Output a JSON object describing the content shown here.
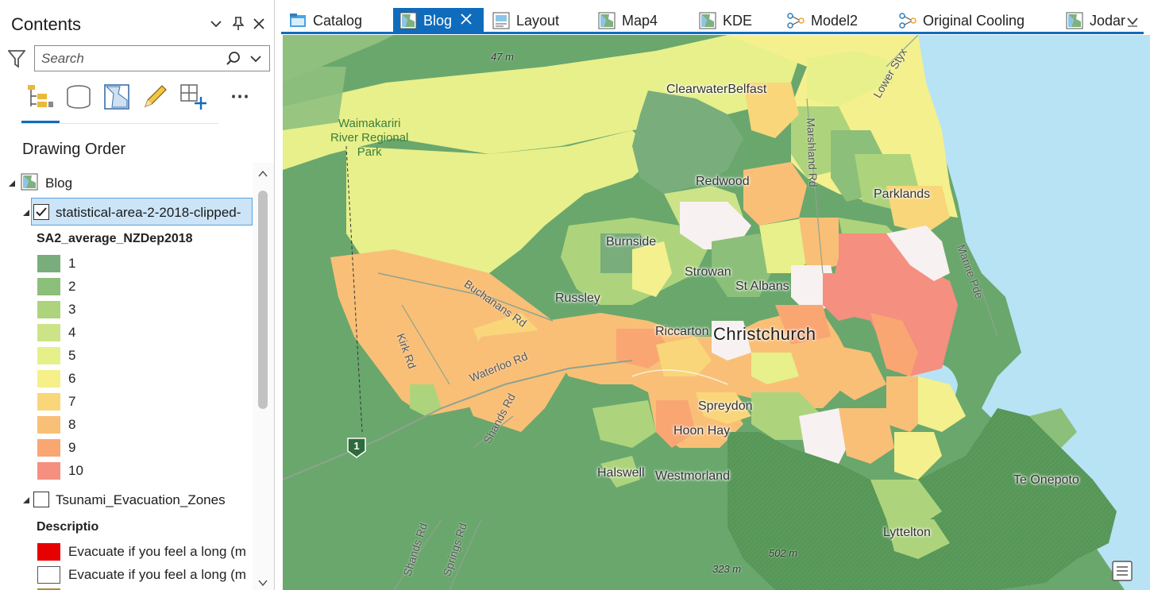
{
  "contents": {
    "title": "Contents",
    "search_placeholder": "Search",
    "section_title": "Drawing Order",
    "map_name": "Blog",
    "layer1": {
      "name": "statistical-area-2-2018-clipped-",
      "checked": true,
      "field": "SA2_average_NZDep2018",
      "classes": [
        {
          "label": "1",
          "color": "#79ae7c"
        },
        {
          "label": "2",
          "color": "#8cbf79"
        },
        {
          "label": "3",
          "color": "#add47c"
        },
        {
          "label": "4",
          "color": "#cde387"
        },
        {
          "label": "5",
          "color": "#e6f08a"
        },
        {
          "label": "6",
          "color": "#f6f08a"
        },
        {
          "label": "7",
          "color": "#f9d67a"
        },
        {
          "label": "8",
          "color": "#f9bf77"
        },
        {
          "label": "9",
          "color": "#f9a673"
        },
        {
          "label": "10",
          "color": "#f58f80"
        }
      ]
    },
    "layer2": {
      "name": "Tsunami_Evacuation_Zones",
      "checked": false,
      "field": "Descriptio",
      "classes": [
        {
          "label": "Evacuate if you feel a long (m",
          "color": "#e60000"
        },
        {
          "label": "Evacuate if you feel a long (m",
          "color": "#ffffff"
        }
      ]
    }
  },
  "tabs": [
    {
      "label": "Catalog",
      "icon": "catalog-icon",
      "active": false
    },
    {
      "label": "Blog",
      "icon": "map-icon",
      "active": true
    },
    {
      "label": "Layout",
      "icon": "layout-icon",
      "active": false
    },
    {
      "label": "Map4",
      "icon": "map-icon",
      "active": false
    },
    {
      "label": "KDE",
      "icon": "map-icon",
      "active": false
    },
    {
      "label": "Model2",
      "icon": "model-icon",
      "active": false
    },
    {
      "label": "Original Cooling",
      "icon": "model-icon",
      "active": false
    },
    {
      "label": "Jodar",
      "icon": "map-icon",
      "active": false
    }
  ],
  "map": {
    "labels": {
      "clearwater": "ClearwaterBelfast",
      "waimakariri": "Waimakariri\nRiver Regional\nPark",
      "redwood": "Redwood",
      "parklands": "Parklands",
      "burnside": "Burnside",
      "strowan": "Strowan",
      "st_albans": "St Albans",
      "russley": "Russley",
      "riccarton": "Riccarton",
      "christchurch": "Christchurch",
      "spreydon": "Spreydon",
      "hoon_hay": "Hoon Hay",
      "halswell": "Halswell",
      "westmorland": "Westmorland",
      "te_onepoto": "Te Onepoto",
      "lyttelton": "Lyttelton",
      "buchanans": "Buchanans Rd",
      "kirk": "Kirk Rd",
      "waterloo": "Waterloo Rd",
      "shands1": "Shands Rd",
      "shands2": "Shands Rd",
      "springs": "Springs Rd",
      "marshland": "Marshland Rd",
      "marine": "Marine Pde",
      "lower_styx": "Lower Styx",
      "elev_47": "47 m",
      "elev_502": "502 m",
      "elev_323": "323 m",
      "hwy": "1"
    }
  }
}
